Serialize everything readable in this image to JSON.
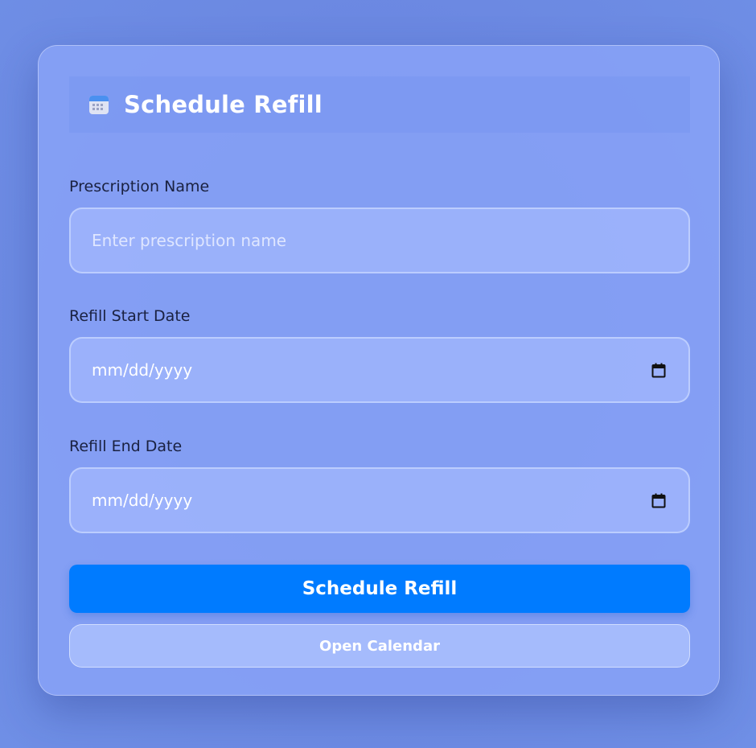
{
  "header": {
    "title": "Schedule Refill",
    "icon": "calendar-icon"
  },
  "form": {
    "prescription": {
      "label": "Prescription Name",
      "placeholder": "Enter prescription name",
      "value": ""
    },
    "start_date": {
      "label": "Refill Start Date",
      "value": "mm/dd/yyyy",
      "icon": "calendar-picker-icon"
    },
    "end_date": {
      "label": "Refill End Date",
      "value": "mm/dd/yyyy",
      "icon": "calendar-picker-icon"
    }
  },
  "actions": {
    "primary_label": "Schedule Refill",
    "secondary_label": "Open Calendar"
  },
  "colors": {
    "primary": "#007bff",
    "background": "#6b88e2"
  }
}
